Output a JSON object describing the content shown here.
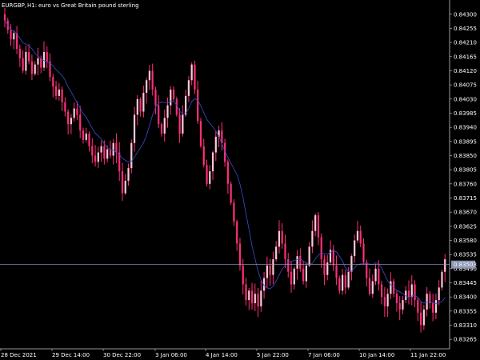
{
  "header": {
    "symbol": "EURGBP,",
    "timeframe": "H1:",
    "description": "euro vs Great Britain pound sterling"
  },
  "colors": {
    "background": "#000000",
    "frame": "#c8c8c8",
    "candle": "#ff2f7a",
    "candle_light": "#ffc8d8",
    "ma_line": "#3a4fd0",
    "price_line": "#9aa4c0",
    "price_tag_bg": "#8a96b4"
  },
  "chart_data": {
    "type": "candlestick",
    "symbol": "EURGBP",
    "timeframe": "H1",
    "y_ticks": [
      "0.84300",
      "0.84255",
      "0.84210",
      "0.84165",
      "0.84120",
      "0.84075",
      "0.84030",
      "0.83985",
      "0.83940",
      "0.83895",
      "0.83850",
      "0.83805",
      "0.83760",
      "0.83715",
      "0.83670",
      "0.83625",
      "0.83580",
      "0.83535",
      "0.83490",
      "0.83445",
      "0.83400",
      "0.83355",
      "0.83310",
      "0.83265"
    ],
    "ylim": [
      0.8324,
      0.8433
    ],
    "x_ticks": [
      "28 Dec 2021",
      "29 Dec 14:00",
      "30 Dec 22:00",
      "3 Jan 06:00",
      "4 Jan 14:00",
      "5 Jan 22:00",
      "7 Jan 06:00",
      "10 Jan 14:00",
      "11 Jan 22:00"
    ],
    "current_price": "0.83503",
    "indicator": "moving average",
    "close_series": [
      0.8428,
      0.8425,
      0.8422,
      0.8424,
      0.8419,
      0.8416,
      0.8412,
      0.8418,
      0.8415,
      0.8411,
      0.8414,
      0.8416,
      0.8413,
      0.8418,
      0.8415,
      0.841,
      0.8407,
      0.8404,
      0.8406,
      0.8402,
      0.8399,
      0.8395,
      0.8397,
      0.84,
      0.8398,
      0.8393,
      0.839,
      0.8392,
      0.8388,
      0.8385,
      0.8383,
      0.8386,
      0.8388,
      0.8384,
      0.8387,
      0.8385,
      0.8389,
      0.8386,
      0.838,
      0.8373,
      0.8377,
      0.8381,
      0.8389,
      0.8398,
      0.8403,
      0.8399,
      0.8405,
      0.8409,
      0.8412,
      0.8406,
      0.8401,
      0.8395,
      0.8392,
      0.8397,
      0.8401,
      0.8406,
      0.8403,
      0.8398,
      0.8392,
      0.8398,
      0.8404,
      0.8409,
      0.8414,
      0.8406,
      0.8396,
      0.8388,
      0.8382,
      0.8376,
      0.838,
      0.8386,
      0.8391,
      0.8393,
      0.8389,
      0.8383,
      0.8376,
      0.837,
      0.8364,
      0.8357,
      0.835,
      0.8344,
      0.8339,
      0.8342,
      0.8338,
      0.8341,
      0.8337,
      0.8342,
      0.8346,
      0.835,
      0.8347,
      0.8352,
      0.8356,
      0.8361,
      0.8357,
      0.8352,
      0.8348,
      0.8344,
      0.8349,
      0.8353,
      0.8349,
      0.8345,
      0.835,
      0.8356,
      0.8361,
      0.8366,
      0.8359,
      0.8352,
      0.8347,
      0.8351,
      0.8355,
      0.835,
      0.8346,
      0.8342,
      0.8347,
      0.8343,
      0.8348,
      0.8353,
      0.8358,
      0.8361,
      0.8357,
      0.8351,
      0.8346,
      0.8341,
      0.8345,
      0.8349,
      0.8344,
      0.834,
      0.8337,
      0.8341,
      0.8345,
      0.8341,
      0.8338,
      0.8336,
      0.8339,
      0.8342,
      0.834,
      0.8344,
      0.8339,
      0.8335,
      0.8331,
      0.8336,
      0.8341,
      0.8338,
      0.8335,
      0.8339,
      0.8343,
      0.8348,
      0.8352
    ]
  }
}
